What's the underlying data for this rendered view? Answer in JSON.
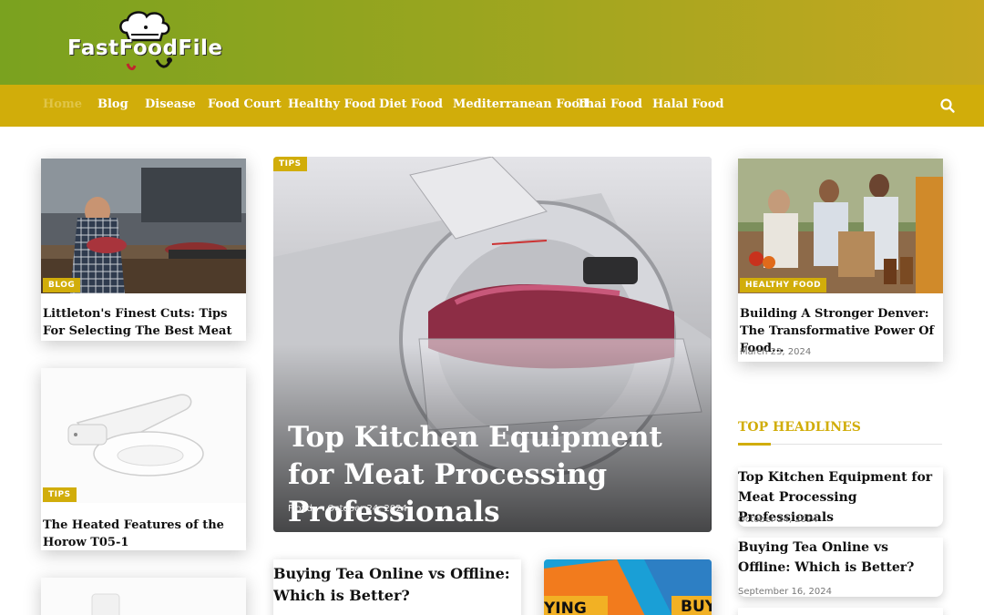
{
  "site": {
    "name": "FastFoodFile"
  },
  "nav": {
    "items": [
      "Home",
      "Blog",
      "Disease",
      "Food Court",
      "Healthy Food",
      "Diet Food",
      "Mediterranean Food",
      "Thai Food",
      "Halal Food"
    ]
  },
  "colors": {
    "accent": "#d1ad0a",
    "header_left": "#7aa21f",
    "header_right": "#c6a81f"
  },
  "left_cards": [
    {
      "badge": "BLOG",
      "title": "Littleton's Finest Cuts: Tips For Selecting The Best Meat Market In..."
    },
    {
      "badge": "TIPS",
      "title": "The Heated Features of the Horow T05-1"
    }
  ],
  "hero": {
    "badge": "TIPS",
    "title": "Top Kitchen Equipment for Meat Processing Professionals",
    "meta": "Floyd — October 24, 2024"
  },
  "bottom_card": {
    "title": "Buying Tea Online vs Offline: Which is Better?",
    "img_text_left": "YING",
    "img_text_right": "BUY"
  },
  "right_card": {
    "badge": "HEALTHY FOOD",
    "title": "Building A Stronger Denver: The Transformative Power Of Food...",
    "date": "March 23, 2024"
  },
  "top_headlines": {
    "heading": "TOP HEADLINES",
    "items": [
      {
        "title": "Top Kitchen Equipment for Meat Processing Professionals",
        "date": "October 24, 2024"
      },
      {
        "title": "Buying Tea Online vs Offline: Which is Better?",
        "date": "September 16, 2024"
      }
    ]
  }
}
